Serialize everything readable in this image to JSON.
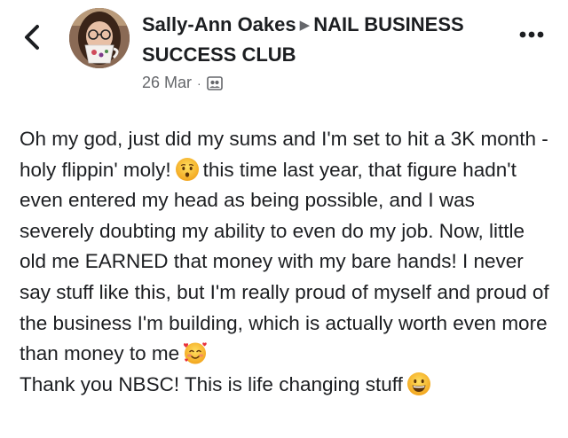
{
  "header": {
    "back_icon": "chevron-left-icon",
    "author_name": "Sally-Ann Oakes",
    "arrow_glyph": "▶",
    "group_name": "NAIL BUSINESS SUCCESS CLUB",
    "date": "26 Mar",
    "separator": "·",
    "audience_icon": "group-members-icon",
    "more_icon": "more-horizontal-icon"
  },
  "post": {
    "paragraph1_part1": "Oh my god, just did my sums and I'm set to hit a 3K month - holy flippin' moly!",
    "emoji1": "hushed-face-emoji",
    "paragraph1_part2": "this time last year, that figure hadn't even entered my head as being possible, and I was severely doubting my ability to even do my job. Now, little old me EARNED that money with my bare hands!  I never say stuff like this, but I'm really proud of myself and proud of the business I'm building, which is actually worth even more than money to me",
    "emoji2": "smiling-face-with-hearts-emoji",
    "paragraph2": "Thank you NBSC! This is life changing stuff",
    "emoji3": "grinning-face-emoji"
  },
  "colors": {
    "text": "#1c1e21",
    "secondary_text": "#65676b",
    "emoji_yellow": "#f7c22e"
  }
}
